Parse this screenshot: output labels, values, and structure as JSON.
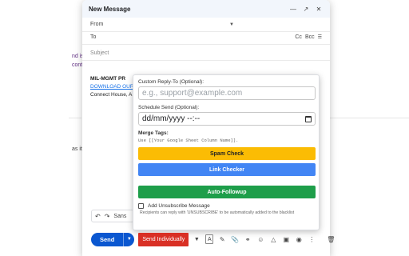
{
  "background": {
    "fragments": [
      "nd is",
      "conta",
      "as its"
    ]
  },
  "compose": {
    "title": "New Message",
    "from_label": "From",
    "to_label": "To",
    "cc_label": "Cc",
    "bcc_label": "Bcc",
    "subject_placeholder": "Subject",
    "signature": {
      "name": "MIL-MGMT PR",
      "link": "DOWNLOAD OUR",
      "address": "Connect House, A"
    }
  },
  "panel": {
    "reply_to_label": "Custom Reply-To (Optional):",
    "reply_to_placeholder": "e.g., support@example.com",
    "schedule_label": "Schedule Send (Optional):",
    "schedule_value": "dd/mm/yyyy --:--",
    "merge_title": "Merge Tags:",
    "merge_hint": "Use [[Your Google Sheet Column Name]].",
    "spam_button": "Spam Check",
    "link_button": "Link Checker",
    "followup_button": "Auto-Followup",
    "unsubscribe_label": "Add Unsubscribe Message",
    "unsubscribe_note": "Recipients can reply with 'UNSUBSCRIBE' to be automatically added to the blacklist"
  },
  "format_bar": {
    "font_text": "Sans"
  },
  "toolbar": {
    "send_label": "Send",
    "send_individually_label": "Send Individually"
  },
  "colors": {
    "send": "#0b57d0",
    "send_individually": "#d93025",
    "spam": "#fbbc04",
    "link": "#4285f4",
    "followup": "#1e9e4a"
  }
}
